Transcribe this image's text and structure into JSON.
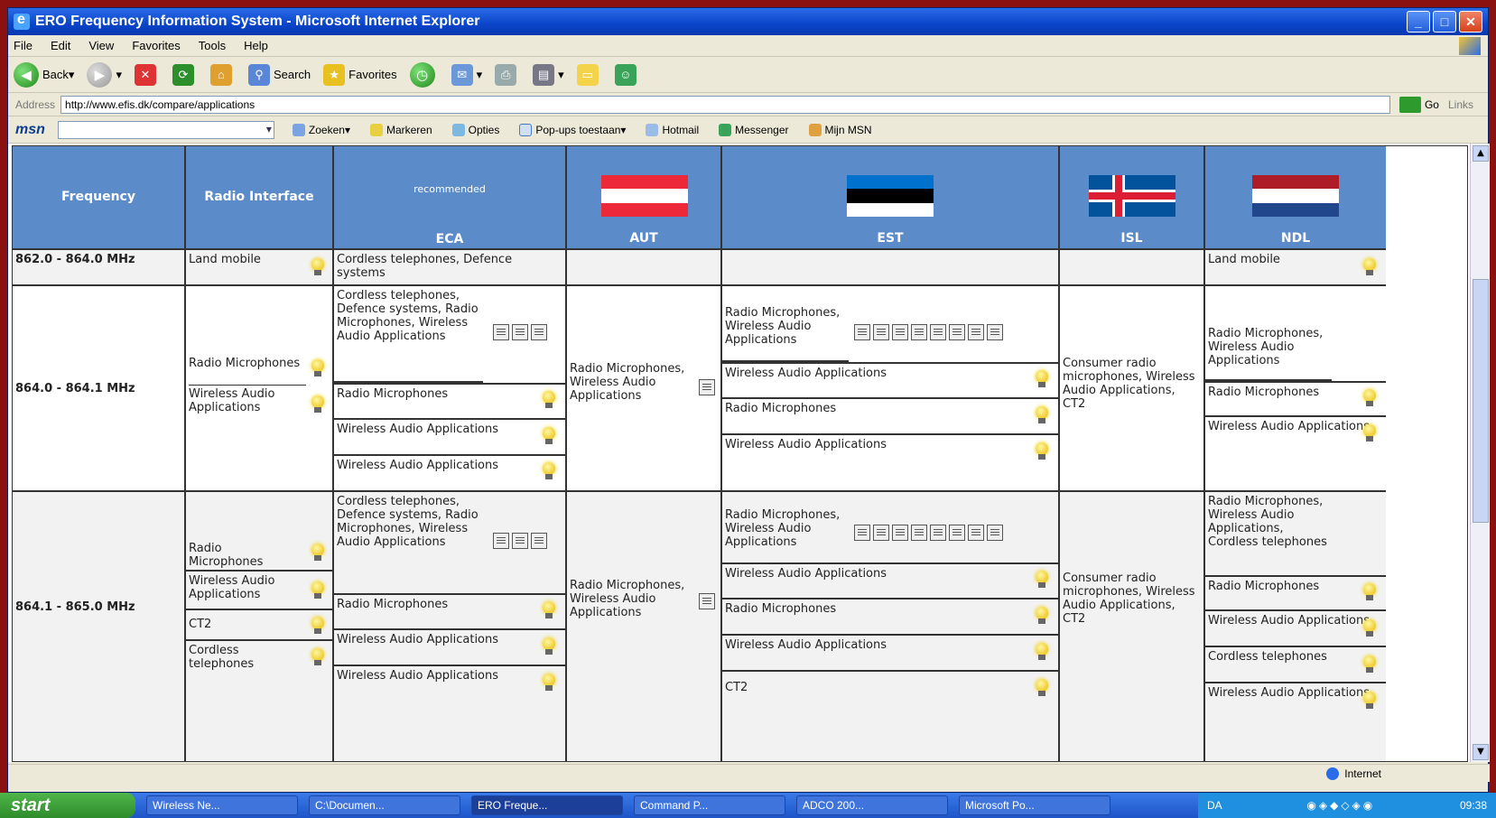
{
  "window": {
    "title": "ERO Frequency Information System - Microsoft Internet Explorer"
  },
  "menu": [
    "File",
    "Edit",
    "View",
    "Favorites",
    "Tools",
    "Help"
  ],
  "toolbar": {
    "back": "Back",
    "search": "Search",
    "favorites": "Favorites"
  },
  "address": {
    "label": "Address",
    "url": "http://www.efis.dk/compare/applications",
    "go": "Go",
    "links": "Links"
  },
  "msn": {
    "logo": "msn",
    "items": [
      "Zoeken",
      "Markeren",
      "Opties",
      "Pop-ups toestaan",
      "Hotmail",
      "Messenger",
      "Mijn MSN"
    ]
  },
  "table": {
    "headers": {
      "frequency": "Frequency",
      "radio_interface": "Radio Interface",
      "eca_top": "recommended",
      "eca": "ECA",
      "aut": "AUT",
      "est": "EST",
      "isl": "ISL",
      "nld": "NDL"
    },
    "row1": {
      "freq": "862.0 - 864.0 MHz",
      "ri": "Land mobile",
      "eca": "Cordless telephones, Defence systems",
      "nld": "Land mobile"
    },
    "row2": {
      "freq": "864.0 - 864.1 MHz",
      "ri": [
        "Radio Microphones",
        "Wireless Audio Applications"
      ],
      "eca": [
        "Cordless telephones, Defence systems, Radio Microphones, Wireless Audio Applications",
        "Radio Microphones",
        "Wireless Audio Applications",
        "Wireless Audio Applications"
      ],
      "aut": "Radio Microphones, Wireless Audio Applications",
      "est": [
        "Radio Microphones, Wireless Audio Applications",
        "Wireless Audio Applications",
        "Radio Microphones",
        "Wireless Audio Applications"
      ],
      "isl": "Consumer radio microphones, Wireless Audio Applications, CT2",
      "nld": [
        "Radio Microphones, Wireless Audio Applications",
        "Radio Microphones",
        "Wireless Audio Applications"
      ]
    },
    "row3": {
      "freq": "864.1 - 865.0 MHz",
      "ri": [
        "Radio Microphones",
        "Wireless Audio Applications",
        "CT2",
        "Cordless telephones"
      ],
      "eca": [
        "Cordless telephones, Defence systems, Radio Microphones, Wireless Audio Applications",
        "Radio Microphones",
        "Wireless Audio Applications",
        "Wireless Audio Applications"
      ],
      "aut": "Radio Microphones, Wireless Audio Applications",
      "est": [
        "Radio Microphones, Wireless Audio Applications",
        "Wireless Audio Applications",
        "Radio Microphones",
        "Wireless Audio Applications",
        "CT2"
      ],
      "isl": "Consumer radio microphones, Wireless Audio Applications, CT2",
      "nld": [
        "Radio Microphones, Wireless Audio Applications, Cordless telephones",
        "Radio Microphones",
        "Wireless Audio Applications",
        "Cordless telephones",
        "Wireless Audio Applications"
      ]
    }
  },
  "status": {
    "zone": "Internet"
  },
  "taskbar": {
    "start": "start",
    "tasks": [
      "Wireless Ne...",
      "C:\\Documen...",
      "ERO Freque...",
      "Command P...",
      "ADCO 200...",
      "Microsoft Po..."
    ],
    "lang": "DA",
    "time": "09:38"
  }
}
